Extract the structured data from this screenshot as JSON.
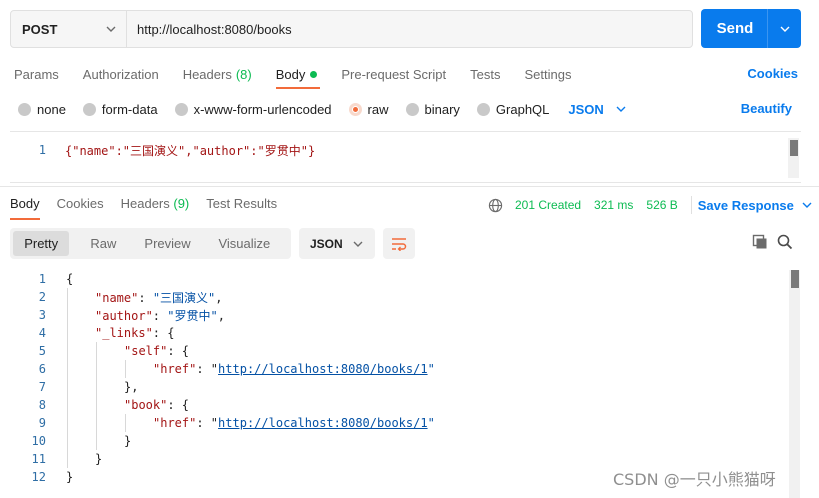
{
  "request": {
    "method": "POST",
    "url": "http://localhost:8080/books",
    "send_label": "Send"
  },
  "request_tabs": {
    "params": "Params",
    "authorization": "Authorization",
    "headers": "Headers",
    "headers_count": "(8)",
    "body": "Body",
    "prerequest": "Pre-request Script",
    "tests": "Tests",
    "settings": "Settings",
    "cookies": "Cookies"
  },
  "body_types": {
    "none": "none",
    "form_data": "form-data",
    "urlencoded": "x-www-form-urlencoded",
    "raw": "raw",
    "binary": "binary",
    "graphql": "GraphQL",
    "selected": "raw",
    "language": "JSON",
    "beautify": "Beautify"
  },
  "request_body": {
    "line_number": "1",
    "text": "{\"name\":\"三国演义\",\"author\":\"罗贯中\"}"
  },
  "response_tabs": {
    "body": "Body",
    "cookies": "Cookies",
    "headers": "Headers",
    "headers_count": "(9)",
    "test_results": "Test Results"
  },
  "response_meta": {
    "status": "201 Created",
    "time": "321 ms",
    "size": "526 B",
    "save": "Save Response"
  },
  "view_modes": {
    "pretty": "Pretty",
    "raw": "Raw",
    "preview": "Preview",
    "visualize": "Visualize",
    "format": "JSON"
  },
  "response_body": {
    "line_numbers": [
      "1",
      "2",
      "3",
      "4",
      "5",
      "6",
      "7",
      "8",
      "9",
      "10",
      "11",
      "12"
    ],
    "t1": "{",
    "k2": "\"name\"",
    "v2": "\"三国演义\"",
    "k3": "\"author\"",
    "v3": "\"罗贯中\"",
    "k4": "\"_links\"",
    "k5": "\"self\"",
    "k6": "\"href\"",
    "v6": "http://localhost:8080/books/1",
    "t7": "},",
    "k8": "\"book\"",
    "k9": "\"href\"",
    "v9": "http://localhost:8080/books/1",
    "t10": "}",
    "t11": "}",
    "t12": "}"
  },
  "watermark": "CSDN @一只小熊猫呀",
  "colors": {
    "accent_blue": "#097bed",
    "accent_orange": "#f26b3a",
    "success_green": "#0cbb52"
  }
}
